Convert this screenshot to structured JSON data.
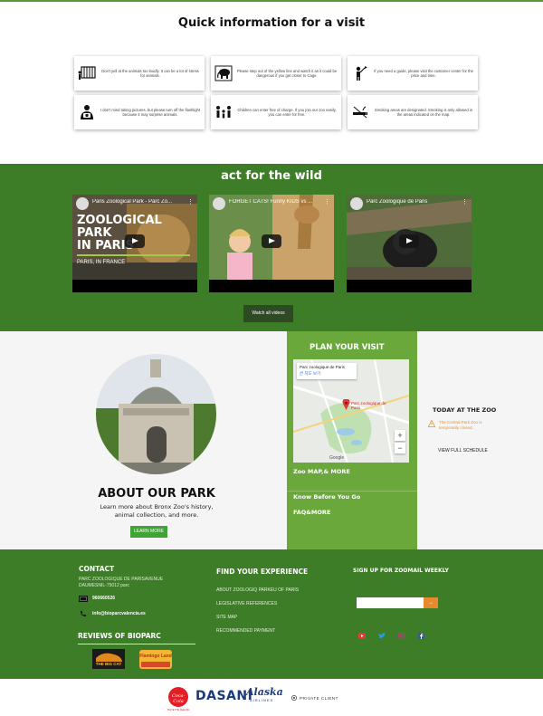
{
  "quick_info": {
    "title": "Quick information for a visit",
    "cards": [
      {
        "icon": "cage-animal-icon",
        "text": "Don't yell at the animals too loudly. It can be a lot of stress for animals."
      },
      {
        "icon": "elephant-icon",
        "text": "Please step out of the yellow line and watch it as it could be dangerous if you get closer to Cage."
      },
      {
        "icon": "guide-person-icon",
        "text": "If you need a guide, please visit the customer center for the price and time."
      },
      {
        "icon": "camera-person-icon",
        "text": "I don't mind taking pictures, but please turn off the flashlight because it may surprise animals."
      },
      {
        "icon": "family-icon",
        "text": "Children can enter free of charge. If you join our zoo easily, you can enter for free."
      },
      {
        "icon": "no-smoking-icon",
        "text": "Smoking areas are designated. Smoking is only allowed in the areas indicated on the map."
      }
    ]
  },
  "wild": {
    "title": "act for the wild",
    "videos": [
      {
        "title": "Paris Zoological Park - Parc Zo...",
        "overlay": [
          "ZOOLOGICAL",
          "PARK",
          "IN PARIS"
        ],
        "overlay_sub": "PARIS, IN FRANCE"
      },
      {
        "title": "FORGET CATS! Funny KIDS vs ..."
      },
      {
        "title": "Parc Zoologique de Paris"
      }
    ],
    "watch_all": "Watch all videos"
  },
  "about": {
    "title": "ABOUT OUR PARK",
    "subtitle": "Learn more about Bronx Zoo's history, animal collection, and more.",
    "button": "LEARN MORE"
  },
  "plan": {
    "title": "PLAN YOUR VISIT",
    "map_card_title": "Parc zoologique de Paris",
    "map_card_sub": "큰 지도 보기",
    "map_pin_label": "Parc zoologique de Paris",
    "map_footer": "Google",
    "zoo_map": "Zoo MAP,& MORE",
    "know_before": "Know Before You Go",
    "faq": "FAQ&MORE"
  },
  "today": {
    "title": "TODAY AT THE ZOO",
    "alert": "The Central Park Zoo is temporarily closed.",
    "schedule": "VIEW FULL SCHEDULE"
  },
  "footer": {
    "contact_title": "CONTACT",
    "address": "PARC ZOOLOGIQUE DE PARISAVENUE DAUMESNIL-75012 parc",
    "phone": "960660526",
    "email": "info@bioparcvalencia.es",
    "reviews_title": "REVIEWS OF BIOPARC",
    "badge1": "THE BIG CAT",
    "badge2": "Flamingo Land",
    "find_title": "FIND YOUR EXPERIENCE",
    "links": [
      "ABOUT ZOOLOGIQ PARKEU OF PARIS",
      "LEGISLATIVE REFERENCES",
      "SITE MAP",
      "RECOMMENDED PAYMENT"
    ],
    "signup_title": "SIGN UP FOR ZOOMAIL WEEKLY",
    "go_label": "→",
    "social": [
      "youtube-icon",
      "twitter-icon",
      "instagram-icon",
      "facebook-icon"
    ]
  },
  "sponsors": {
    "coca": "Coca-Cola",
    "coca_sub": "TASTE THE FEELING",
    "dasani": "DASANI",
    "alaska": "Alaska",
    "alaska_sub": "AIRLINES",
    "private": "PRIVATE CLIENT"
  },
  "colors": {
    "green_dark": "#3e7d27",
    "green_plan": "#6aa83b",
    "button_green": "#3ea535",
    "orange": "#e8892e",
    "alert": "#e69520"
  }
}
